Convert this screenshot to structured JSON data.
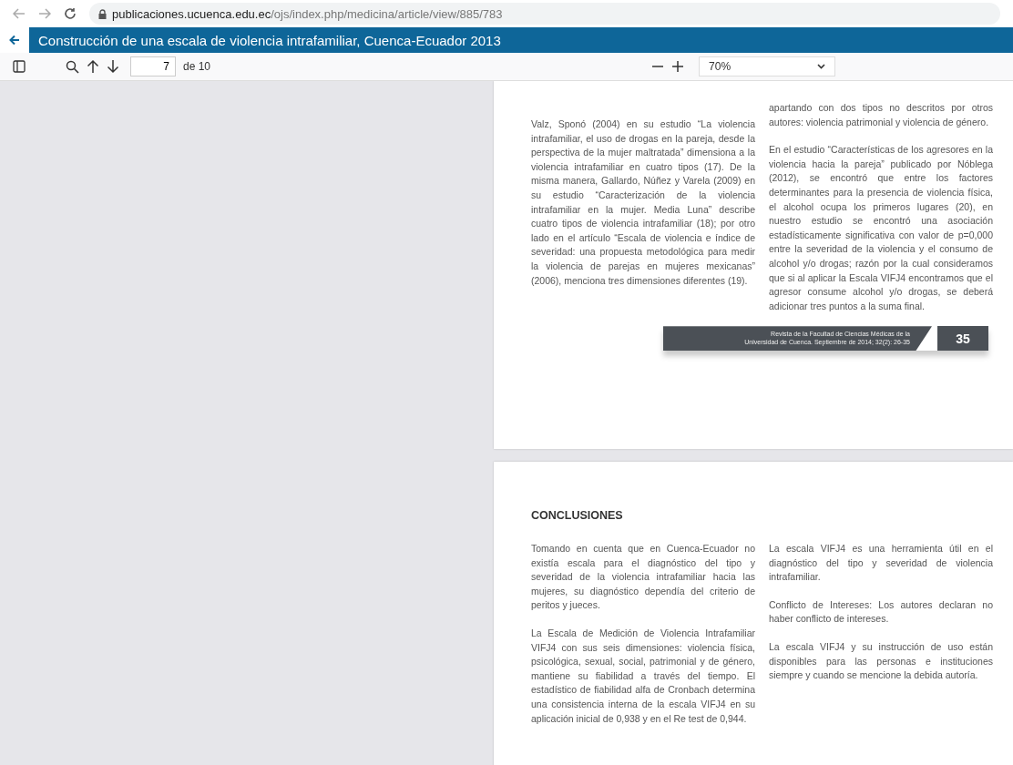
{
  "browser": {
    "url_host": "publicaciones.ucuenca.edu.ec",
    "url_path": "/ojs/index.php/medicina/article/view/885/783"
  },
  "title_bar": {
    "title": "Construcción de una escala de violencia intrafamiliar, Cuenca-Ecuador 2013"
  },
  "toolbar": {
    "page": "7",
    "page_total": "de 10",
    "zoom": "70%"
  },
  "pages": [
    {
      "columns": [
        [
          "Valz, Sponó (2004) en su estudio “La violencia intrafamiliar, el uso de drogas en la pareja, desde la perspectiva de la mujer maltratada” dimensiona a la violencia intrafamiliar en cuatro tipos (17). De la misma manera, Gallardo, Núñez y Varela (2009) en su estudio “Caracterización de la violencia intrafamiliar en la mujer. Media Luna” describe cuatro tipos de violencia intrafamiliar (18); por otro lado en el artículo “Escala de violencia e índice de severidad: una propuesta metodológica para medir la violencia de parejas en mujeres mexicanas” (2006), menciona tres dimensiones diferentes (19)."
        ],
        [
          "apartando con dos tipos no descritos por otros autores: violencia patrimonial y violencia de género.",
          "En el estudio “Características de los agresores en la violencia hacia la pareja” publicado por Nóblega (2012), se encontró que entre los factores determinantes para la presencia de violencia física, el alcohol ocupa los primeros lugares (20), en nuestro estudio se encontró una asociación estadísticamente significativa con valor de p=0,000 entre la severidad de la violencia y el consumo de alcohol y/o drogas; razón por la cual consideramos que si al aplicar la Escala VIFJ4 encontramos que el agresor consume alcohol y/o drogas, se deberá adicionar tres puntos a la suma final."
        ]
      ],
      "footer": {
        "journal": [
          "Revista de la Facultad de Ciencias Médicas de la",
          "Universidad de Cuenca. Septiembre de 2014; 32(2): 26-35"
        ],
        "page_number": "35"
      }
    },
    {
      "heading": "CONCLUSIONES",
      "columns": [
        [
          "Tomando en cuenta que en Cuenca-Ecuador no existía escala para el diagnóstico del tipo y severidad de la violencia intrafamiliar hacia las mujeres, su diagnóstico dependía del criterio de peritos y jueces.",
          "La Escala de Medición de Violencia Intrafamiliar VIFJ4 con sus seis dimensiones: violencia física, psicológica, sexual, social, patrimonial y de género, mantiene su fiabilidad a través del tiempo. El estadístico de fiabilidad alfa de Cronbach determina una consistencia interna de la escala VIFJ4 en su aplicación inicial de 0,938 y en el Re test de 0,944."
        ],
        [
          "La escala VIFJ4 es una herramienta útil en el diagnóstico del tipo y severidad de violencia intrafamiliar.",
          "Conflicto de Intereses: Los autores declaran no haber conflicto de intereses.",
          "La escala VIFJ4 y su instrucción de uso están disponibles para las personas e instituciones siempre y cuando se mencione la debida autoría."
        ]
      ]
    }
  ]
}
